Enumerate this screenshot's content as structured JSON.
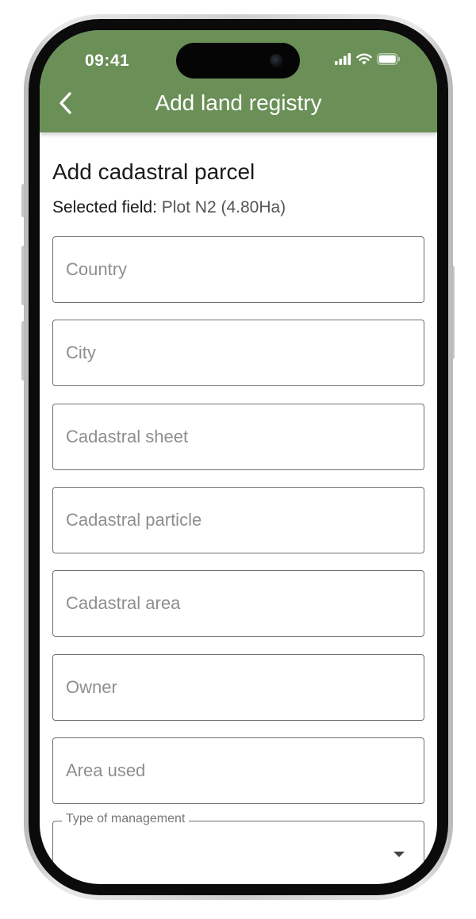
{
  "status_bar": {
    "time": "09:41",
    "icons": [
      "signal-icon",
      "wifi-icon",
      "battery-icon"
    ]
  },
  "header": {
    "back_icon": "chevron-left-icon",
    "title": "Add land registry",
    "background_color": "#6a8f57"
  },
  "form": {
    "title": "Add cadastral parcel",
    "selected_field_label": "Selected field:",
    "selected_field_value": "Plot N2 (4.80Ha)",
    "fields": [
      {
        "name": "country",
        "placeholder": "Country",
        "value": ""
      },
      {
        "name": "city",
        "placeholder": "City",
        "value": ""
      },
      {
        "name": "cadastral-sheet",
        "placeholder": "Cadastral sheet",
        "value": ""
      },
      {
        "name": "cadastral-particle",
        "placeholder": "Cadastral particle",
        "value": ""
      },
      {
        "name": "cadastral-area",
        "placeholder": "Cadastral area",
        "value": ""
      },
      {
        "name": "owner",
        "placeholder": "Owner",
        "value": ""
      },
      {
        "name": "area-used",
        "placeholder": "Area used",
        "value": ""
      }
    ],
    "management_select": {
      "label": "Type of management",
      "selected": ""
    }
  }
}
